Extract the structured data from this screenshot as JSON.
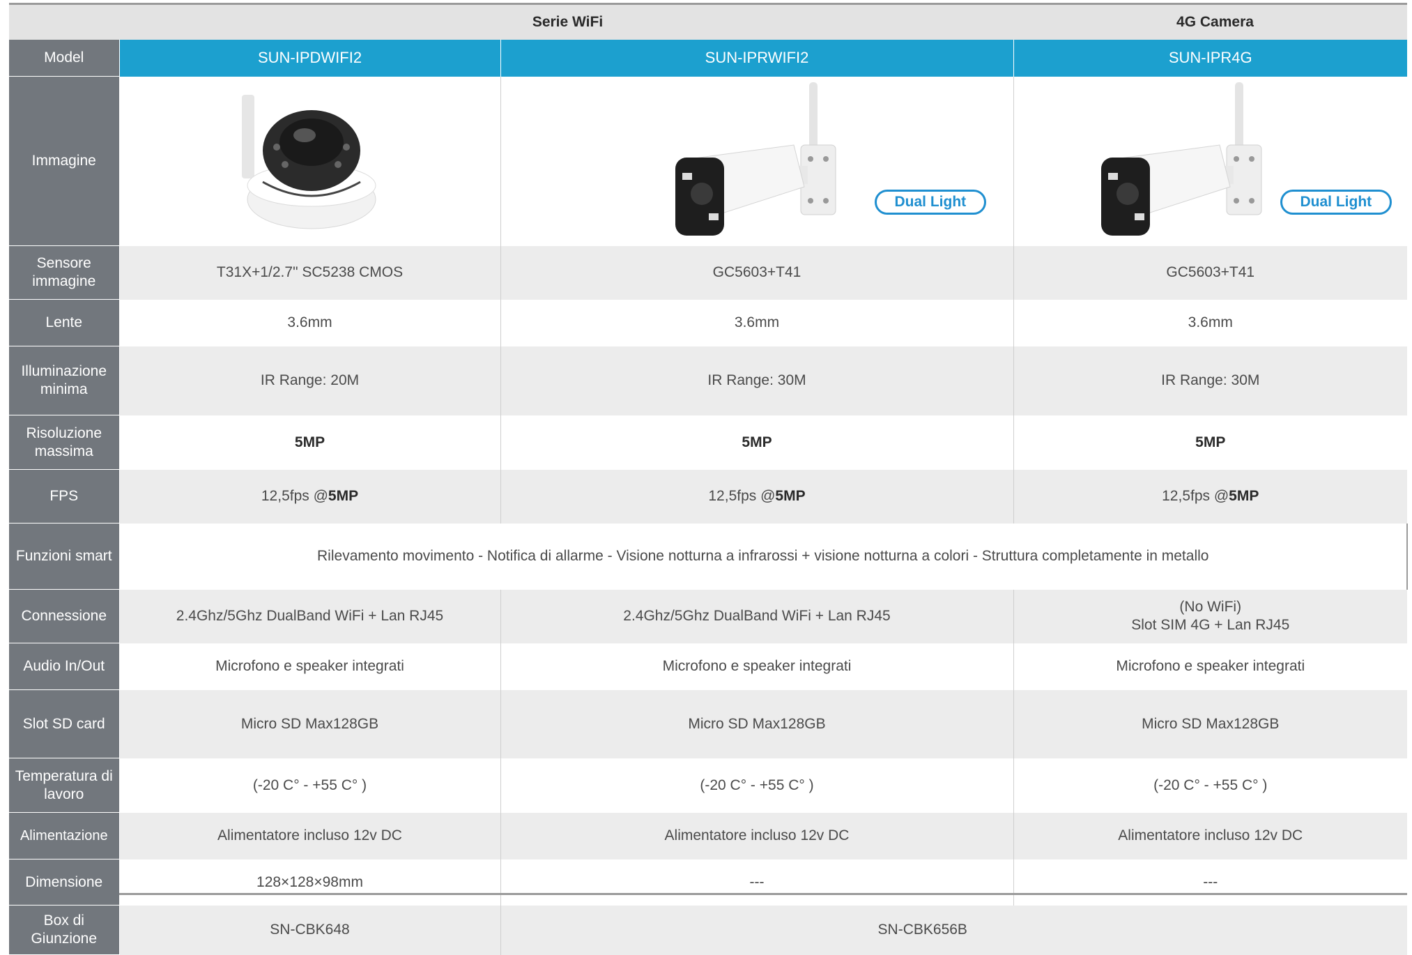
{
  "headers": {
    "series": [
      "Serie WiFi",
      "4G Camera"
    ],
    "model_label": "Model",
    "models": [
      "SUN-IPDWIFI2",
      "SUN-IPRWIFI2",
      "SUN-IPR4G"
    ]
  },
  "image_row": {
    "label": "Immagine",
    "badge": "Dual Light"
  },
  "rows": {
    "sensor": {
      "label": "Sensore immagine",
      "values": [
        "T31X+1/2.7\" SC5238 CMOS",
        "GC5603+T41",
        "GC5603+T41"
      ]
    },
    "lens": {
      "label": "Lente",
      "values": [
        "3.6mm",
        "3.6mm",
        "3.6mm"
      ]
    },
    "illum": {
      "label": "Illuminazione minima",
      "values": [
        "IR Range: 20M",
        "IR Range: 30M",
        "IR Range: 30M"
      ]
    },
    "res": {
      "label": "Risoluzione massima",
      "values": [
        "5MP",
        "5MP",
        "5MP"
      ]
    },
    "fps": {
      "label": "FPS",
      "prefix": "12,5fps @",
      "bold": "5MP"
    },
    "smart": {
      "label": "Funzioni smart",
      "value": "Rilevamento movimento - Notifica di allarme - Visione notturna a infrarossi + visione notturna a colori - Struttura  completamente in metallo"
    },
    "conn": {
      "label": "Connessione",
      "values": [
        "2.4Ghz/5Ghz DualBand WiFi + Lan RJ45",
        "2.4Ghz/5Ghz DualBand WiFi + Lan RJ45"
      ],
      "v3_line1": "(No WiFi)",
      "v3_line2": "Slot SIM 4G + Lan RJ45"
    },
    "audio": {
      "label": "Audio In/Out",
      "values": [
        "Microfono e speaker integrati",
        "Microfono e speaker integrati",
        "Microfono e speaker integrati"
      ]
    },
    "sd": {
      "label": "Slot SD card",
      "values": [
        "Micro SD Max128GB",
        "Micro SD Max128GB",
        "Micro SD Max128GB"
      ]
    },
    "temp": {
      "label": "Temperatura di lavoro",
      "values": [
        "(-20 C° - +55 C° )",
        "(-20 C° - +55 C° )",
        "(-20 C° - +55 C° )"
      ]
    },
    "power": {
      "label": "Alimentazione",
      "values": [
        "Alimentatore incluso 12v DC",
        "Alimentatore incluso 12v DC",
        "Alimentatore incluso 12v DC"
      ]
    },
    "dim": {
      "label": "Dimensione",
      "values": [
        "128×128×98mm",
        "---",
        "---"
      ]
    },
    "box": {
      "label": "Box di Giunzione",
      "values": [
        "SN-CBK648",
        "SN-CBK656B"
      ]
    }
  },
  "colors": {
    "header_blue": "#1ca0cf",
    "label_gray": "#72777d",
    "row_shade": "#ececec",
    "badge_blue": "#1f8fd0"
  }
}
